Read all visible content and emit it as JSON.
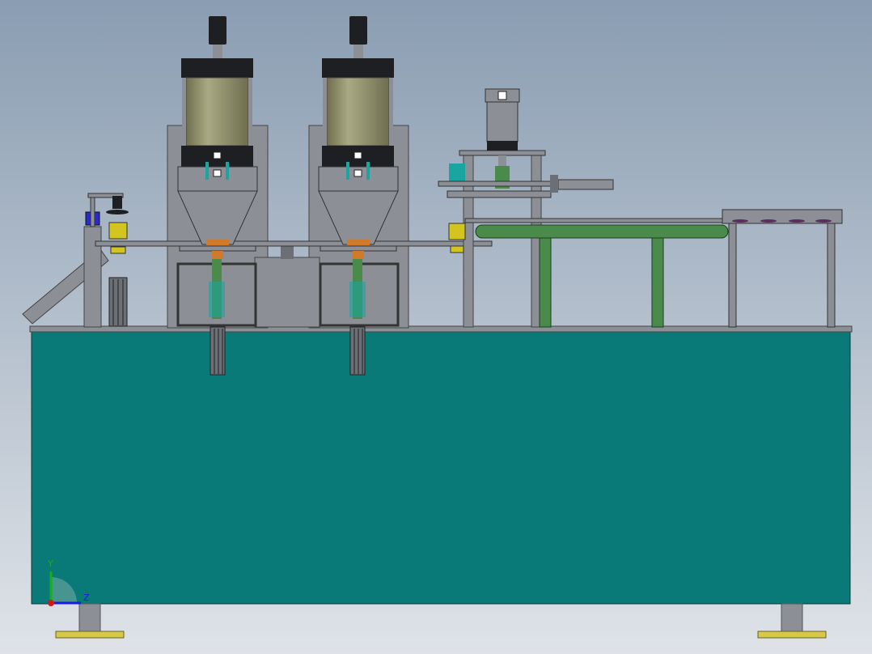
{
  "view": {
    "background_top": "#8a9db2",
    "background_bottom": "#dfe3e8"
  },
  "colors": {
    "base_cabinet": "#0a7a78",
    "frame_gray": "#8c8f96",
    "dark_gray": "#6c6f75",
    "hopper_tank": "#8f8f68",
    "motor_black": "#1e1f22",
    "conveyor_green": "#4a8a4a",
    "teal_motor": "#1aa5a0",
    "yellow_part": "#d3c520",
    "orange_part": "#d07a2a",
    "blue_part": "#2a2ad0",
    "foot_pad": "#d6c94a"
  },
  "triad": {
    "y_label": "Y",
    "z_label": "Z",
    "y_color": "#16b016",
    "z_color": "#1a1ae0",
    "origin_color": "#d01a1a"
  },
  "components": [
    "base-cabinet",
    "filler-hopper-1",
    "filler-hopper-2",
    "rotary-indexer",
    "cylinder-press-station",
    "belt-conveyor",
    "output-table",
    "discharge-chute"
  ]
}
